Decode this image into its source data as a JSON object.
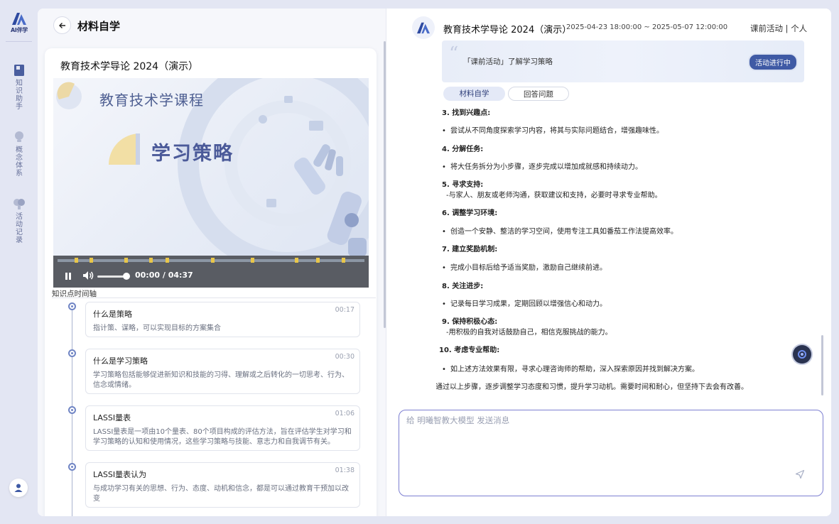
{
  "rail": {
    "logo_text": "AI伴学",
    "items": [
      {
        "label": "知识助手",
        "icon": "book-icon"
      },
      {
        "label": "概念体系",
        "icon": "bulb-icon"
      },
      {
        "label": "活动记录",
        "icon": "record-icon"
      }
    ],
    "user_icon": "user-icon"
  },
  "left": {
    "page_title": "材料自学",
    "panel_title": "教育技术学导论 2024（演示）",
    "video": {
      "course_heading": "教育技术学课程",
      "topic_heading": "学习策略",
      "time_display": "00:00 / 04:37",
      "progress": 0
    },
    "timeline_label": "知识点时间轴",
    "timeline": [
      {
        "title": "什么是策略",
        "time": "00:17",
        "desc": "指计策、谋略，可以实现目标的方案集合"
      },
      {
        "title": "什么是学习策略",
        "time": "00:30",
        "desc": "学习策略包括能够促进新知识和技能的习得、理解或之后转化的一切思考、行为、信念或情绪。"
      },
      {
        "title": "LASSI量表",
        "time": "01:06",
        "desc": "LASSI量表是一项由10个量表、80个项目构成的评估方法，旨在评估学生对学习和学习策略的认知和使用情况，这些学习策略与技能、意志力和自我调节有关。"
      },
      {
        "title": "LASSI量表认为",
        "time": "01:38",
        "desc": "与成功学习有关的思想、行为、态度、动机和信念，都是可以通过教育干预加以改变"
      }
    ]
  },
  "right": {
    "course_title": "教育技术学导论 2024（演示）",
    "date_range": "2025-04-23 18:00:00 ~ 2025-05-07 12:00:00",
    "link_activity": "课前活动",
    "link_sep": "|",
    "link_personal": "个人",
    "banner_text": "「课前活动」了解学习策略",
    "banner_badge": "活动进行中",
    "tabs": [
      "材料自学",
      "回答问题"
    ],
    "content": [
      {
        "head": "3. 找到兴趣点:",
        "body": "尝试从不同角度探索学习内容，将其与实际问题结合，增强趣味性。"
      },
      {
        "head": "4. 分解任务:",
        "body": "将大任务拆分为小步骤，逐步完成以增加成就感和持续动力。"
      },
      {
        "head": "5. 寻求支持:",
        "sub": "-与家人、朋友或老师沟通，获取建议和支持，必要时寻求专业帮助。"
      },
      {
        "head": "6. 调整学习环境:",
        "body": "创造一个安静、整洁的学习空间，使用专注工具如番茄工作法提高效率。"
      },
      {
        "head": "7. 建立奖励机制:",
        "body": "完成小目标后给予适当奖励，激励自己继续前进。"
      },
      {
        "head": "8. 关注进步:",
        "body": "记录每日学习成果，定期回顾以增强信心和动力。"
      },
      {
        "head": "9. 保持积极心态:",
        "sub": "-用积极的自我对话鼓励自己，相信克服挑战的能力。"
      },
      {
        "head": "10. 考虑专业帮助:",
        "body": "如上述方法效果有限，寻求心理咨询师的帮助，深入探索原因并找到解决方案。"
      }
    ],
    "conclusion": "通过以上步骤，逐步调整学习态度和习惯，提升学习动机。需要时间和耐心，但坚持下去会有改善。",
    "input_placeholder": "给 明曦智教大模型 发送消息"
  },
  "colors": {
    "accent": "#3f5aa5",
    "input_border": "#7d7fd1",
    "marker": "#e8c64a"
  }
}
